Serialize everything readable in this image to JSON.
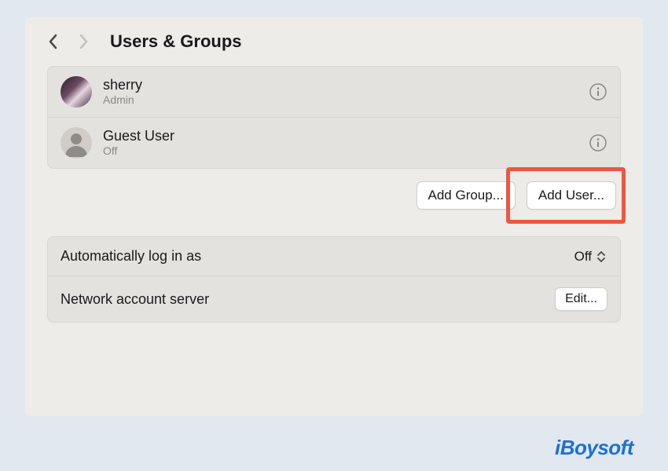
{
  "header": {
    "title": "Users & Groups"
  },
  "users": [
    {
      "name": "sherry",
      "role": "Admin"
    },
    {
      "name": "Guest User",
      "role": "Off"
    }
  ],
  "actions": {
    "add_group": "Add Group...",
    "add_user": "Add User..."
  },
  "settings": {
    "auto_login_label": "Automatically log in as",
    "auto_login_value": "Off",
    "network_server_label": "Network account server",
    "edit_label": "Edit..."
  },
  "watermark": "iBoysoft"
}
